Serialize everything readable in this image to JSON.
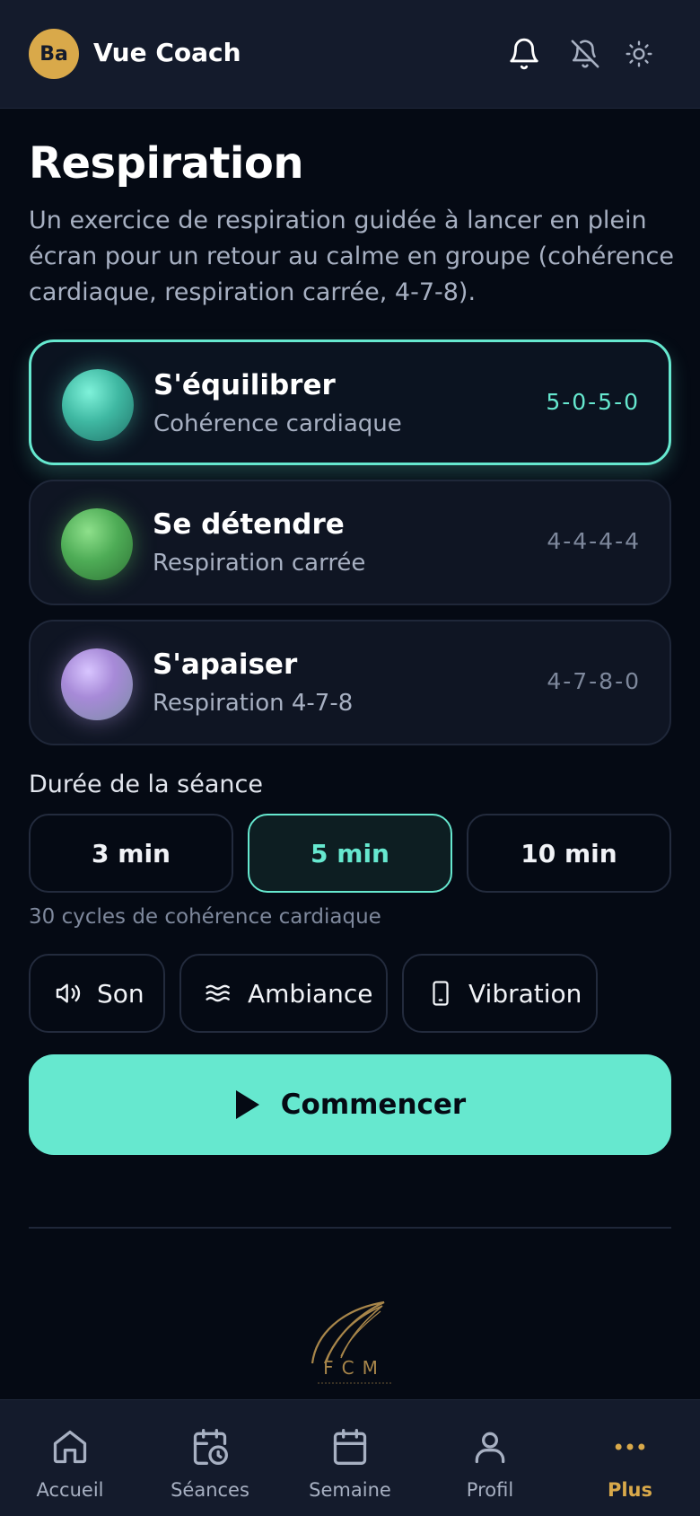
{
  "header": {
    "avatar_initials": "Ba",
    "title": "Vue Coach",
    "icons": [
      "bell-icon",
      "bell-off-icon",
      "sun-icon"
    ]
  },
  "page": {
    "title": "Respiration",
    "intro": "Un exercice de respiration guidée à lancer en plein écran pour un retour au calme en groupe (cohérence cardiaque, respiration carrée, 4-7-8)."
  },
  "exercises": [
    {
      "title": "S'équilibrer",
      "subtitle": "Cohérence cardiaque",
      "pattern": "5-0-5-0",
      "selected": true,
      "orb_color": "#4fc9b2"
    },
    {
      "title": "Se détendre",
      "subtitle": "Respiration carrée",
      "pattern": "4-4-4-4",
      "selected": false,
      "orb_color": "#5fbf5f"
    },
    {
      "title": "S'apaiser",
      "subtitle": "Respiration 4-7-8",
      "pattern": "4-7-8-0",
      "selected": false,
      "orb_color": "#b9a2e6"
    }
  ],
  "duration": {
    "label": "Durée de la séance",
    "options": [
      "3 min",
      "5 min",
      "10 min"
    ],
    "selected": "5 min",
    "cycles_text": "30 cycles de cohérence cardiaque"
  },
  "toggles": {
    "sound": "Son",
    "ambiance": "Ambiance",
    "vibration": "Vibration"
  },
  "start_button": "Commencer",
  "logo_text": "FCM",
  "nav": {
    "items": [
      {
        "label": "Accueil",
        "icon": "home-icon"
      },
      {
        "label": "Séances",
        "icon": "calendar-clock-icon"
      },
      {
        "label": "Semaine",
        "icon": "calendar-icon"
      },
      {
        "label": "Profil",
        "icon": "user-icon"
      },
      {
        "label": "Plus",
        "icon": "more-dots-icon"
      }
    ],
    "active": "Plus"
  },
  "colors": {
    "accent": "#66e8cf",
    "brand_gold": "#d9a94a",
    "background": "#050a14",
    "surface": "#141b2c"
  }
}
